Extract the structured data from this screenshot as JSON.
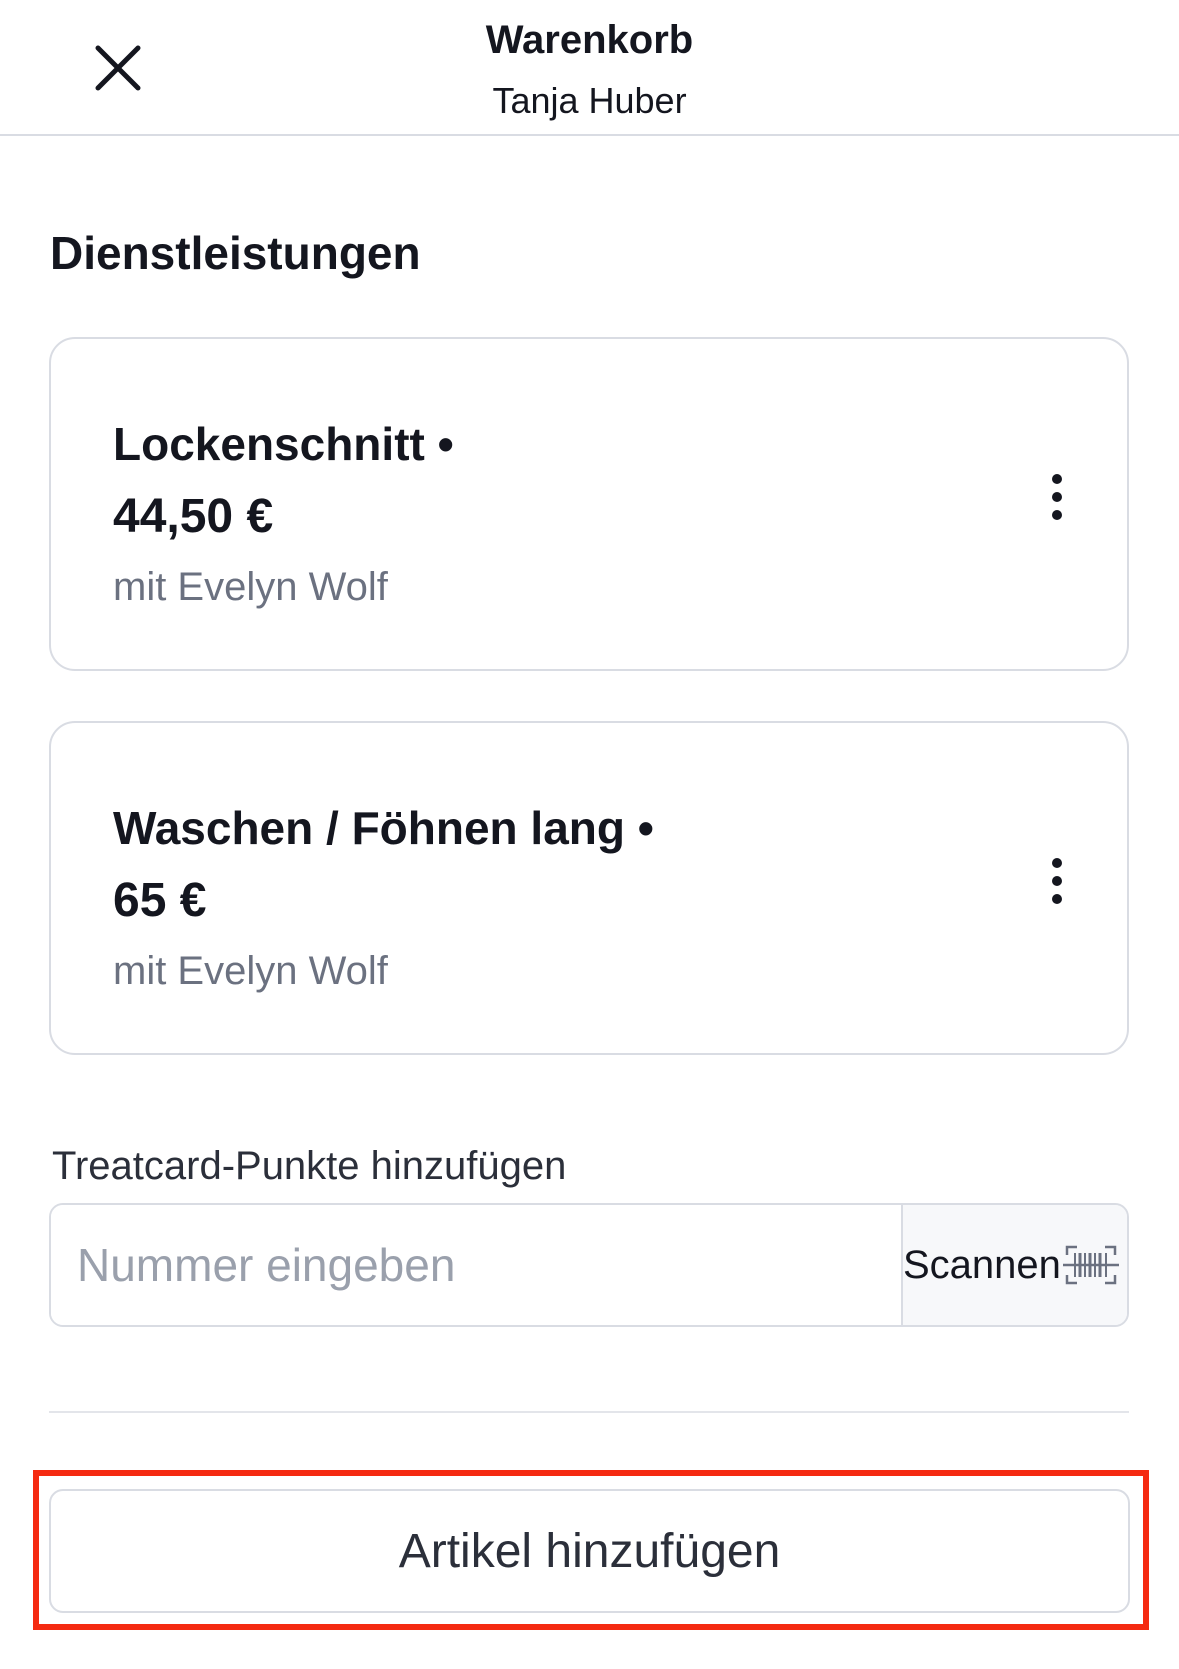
{
  "header": {
    "title": "Warenkorb",
    "subtitle": "Tanja Huber"
  },
  "section": {
    "heading": "Dienstleistungen"
  },
  "services": [
    {
      "name": "Lockenschnitt •",
      "price": "44,50 €",
      "staff": "mit Evelyn Wolf"
    },
    {
      "name": "Waschen / Föhnen lang •",
      "price": "65 €",
      "staff": "mit Evelyn Wolf"
    }
  ],
  "treatcard": {
    "label": "Treatcard-Punkte hinzufügen",
    "placeholder": "Nummer eingeben",
    "value": "",
    "scan_label": "Scannen"
  },
  "actions": {
    "add_item_label": "Artikel hinzufügen"
  },
  "colors": {
    "highlight": "#f52a11",
    "border": "#d9dce3",
    "text": "#14161f",
    "muted": "#6b7180"
  },
  "icons": {
    "close": "close-icon",
    "more": "more-vertical-icon",
    "barcode": "barcode-icon"
  }
}
